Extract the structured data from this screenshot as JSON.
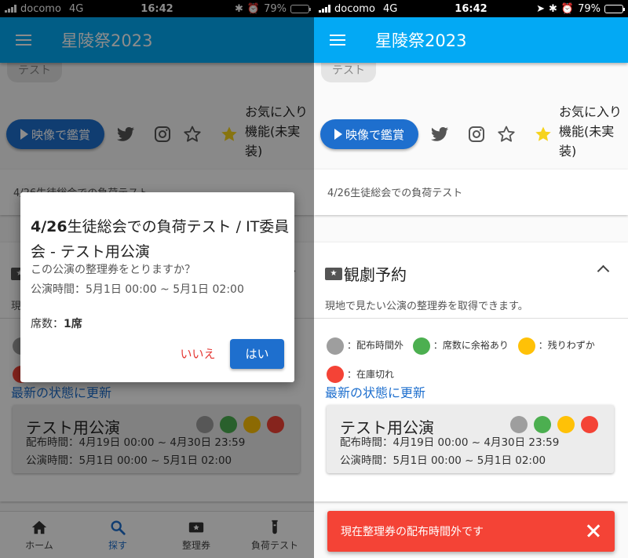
{
  "status_bar": {
    "carrier": "docomo",
    "network": "4G",
    "time": "16:42",
    "battery_label": "79%",
    "battery_level": 0.79
  },
  "app_bar": {
    "title": "星陵祭2023"
  },
  "chip_label": "テスト",
  "actions": {
    "watch_label": "映像で鑑賞",
    "favorite_text": "お気に入り機能(未実装)"
  },
  "load_test_card": {
    "text": "4/26生徒総会での負荷テスト"
  },
  "reservation": {
    "title": "観劇予約",
    "description": "現地で見たい公演の整理券を取得できます。",
    "legend": [
      {
        "label": "：配布時間外",
        "color": "#9e9e9e"
      },
      {
        "label": "：席数に余裕あり",
        "color": "#4caf50"
      },
      {
        "label": "：残りわずか",
        "color": "#ffc107"
      },
      {
        "label": "：在庫切れ",
        "color": "#f44336"
      }
    ],
    "refresh_label": "最新の状態に更新",
    "performance": {
      "name": "テスト用公演",
      "distribution": "配布時間：4月19日 00:00 ~ 4月30日 23:59",
      "show_time": "公演時間：5月1日 00:00 ~ 5月1日 02:00"
    }
  },
  "bottom_nav": [
    {
      "label": "ホーム",
      "icon": "home-icon"
    },
    {
      "label": "探す",
      "icon": "search-icon"
    },
    {
      "label": "整理券",
      "icon": "ticket-icon"
    },
    {
      "label": "負荷テスト",
      "icon": "test-tube-icon"
    }
  ],
  "dialog": {
    "title_bold": "4/26",
    "title_rest": "生徒総会での負荷テスト / IT委員会 - テスト用公演",
    "question": "この公演の整理券をとりますか？",
    "show_time": "公演時間：5月1日 00:00 ~ 5月1日 02:00",
    "seats_label": "席数：",
    "seats_value": "1席",
    "no_label": "いいえ",
    "yes_label": "はい"
  },
  "snackbar": {
    "message": "現在整理券の配布時間外です"
  },
  "colors": {
    "app_bar": "#03a9f4",
    "primary_button": "#1e6fce",
    "snackbar": "#f44336",
    "star_filled": "#f6d31c"
  }
}
